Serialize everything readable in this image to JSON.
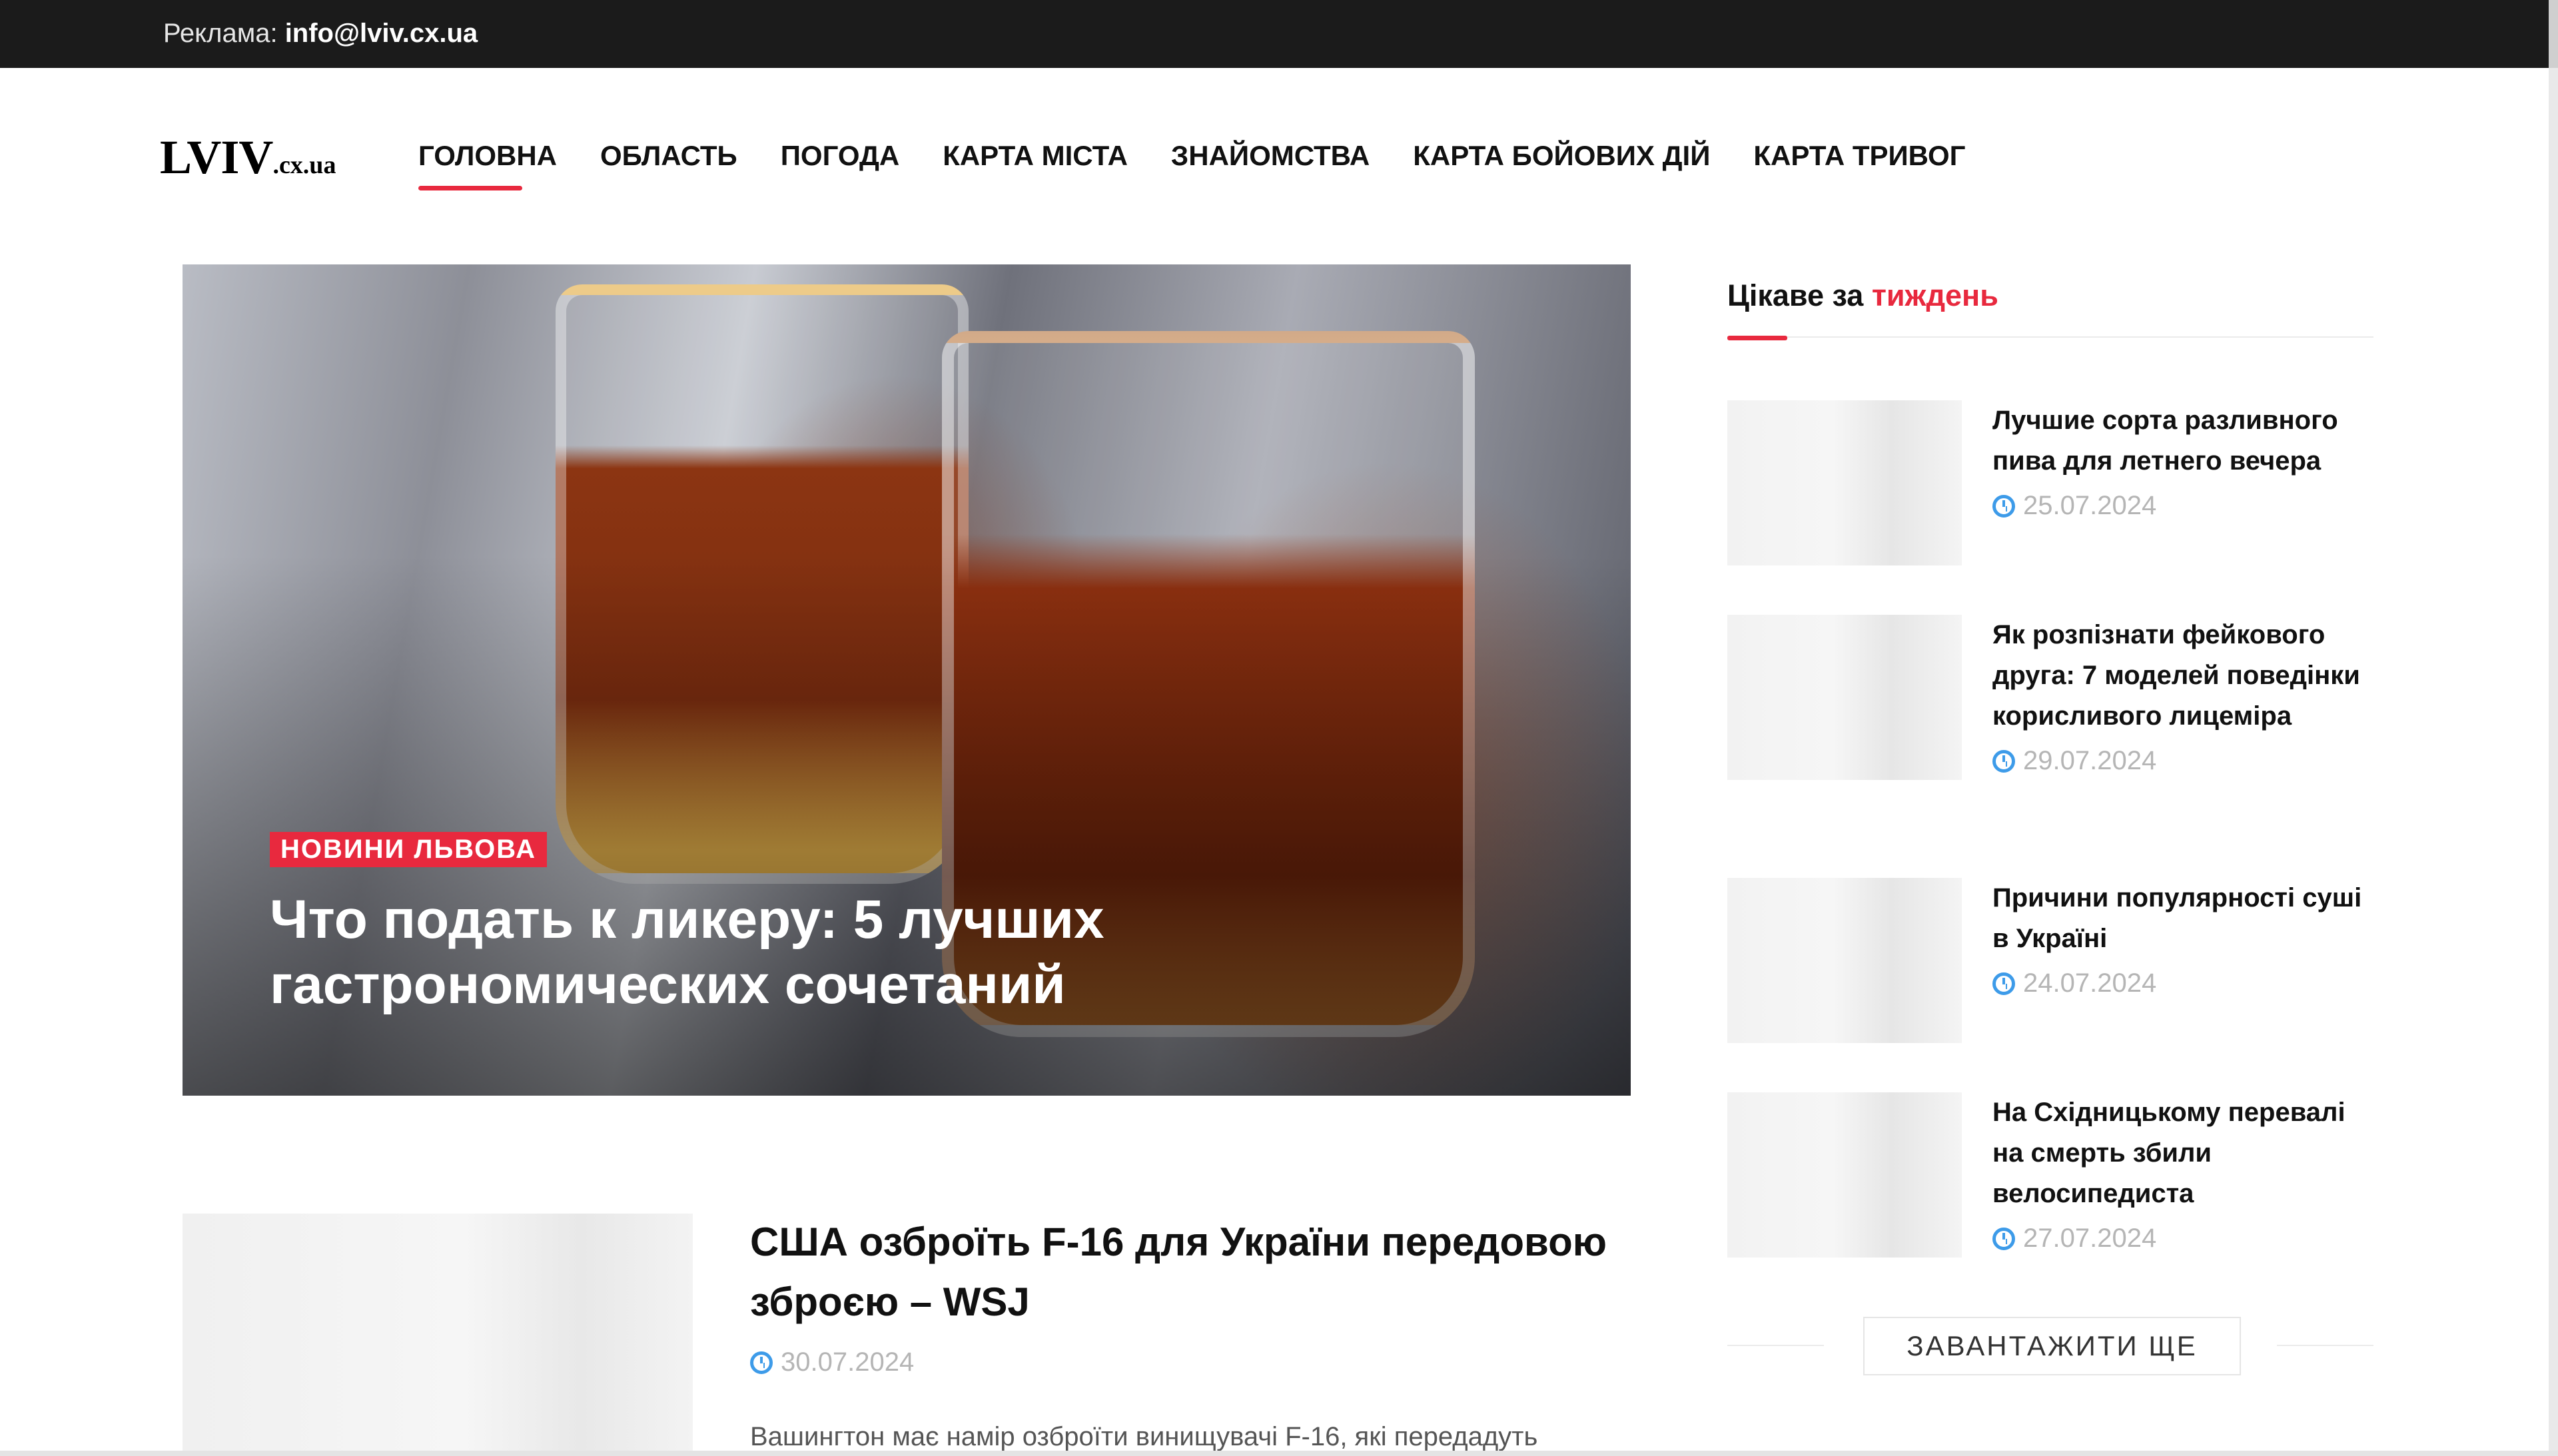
{
  "topbar": {
    "ad_label": "Реклама:",
    "ad_email": "info@lviv.cx.ua"
  },
  "header": {
    "logo_main": "LVIV",
    "logo_suffix": ".cx.ua",
    "nav": [
      {
        "label": "ГОЛОВНА",
        "active": true
      },
      {
        "label": "ОБЛАСТЬ"
      },
      {
        "label": "ПОГОДА"
      },
      {
        "label": "КАРТА МІСТА"
      },
      {
        "label": "ЗНАЙОМСТВА"
      },
      {
        "label": "КАРТА БОЙОВИХ ДІЙ"
      },
      {
        "label": "КАРТА ТРИВОГ"
      }
    ]
  },
  "hero": {
    "category": "НОВИНИ ЛЬВОВА",
    "title": "Что подать к ликеру: 5 лучших гастрономических сочетаний"
  },
  "sidebar": {
    "title_prefix": "Цікаве за",
    "title_accent": "тиждень",
    "items": [
      {
        "title": "Лучшие сорта разливного пива для летнего вечера",
        "date": "25.07.2024"
      },
      {
        "title": "Як розпізнати фейкового друга: 7 моделей поведінки корисливого лицеміра",
        "date": "29.07.2024"
      },
      {
        "title": "Причини популярності суші в Україні",
        "date": "24.07.2024"
      },
      {
        "title": "На Східницькому перевалі на смерть збили велосипедиста",
        "date": "27.07.2024"
      }
    ],
    "load_more": "ЗАВАНТАЖИТИ ЩЕ"
  },
  "article": {
    "title": "США озброїть F-16 для України передовою зброєю – WSJ",
    "date": "30.07.2024",
    "excerpt": "Вашингтон має намір озброїти винищувачі F-16, які передадуть"
  },
  "colors": {
    "accent": "#e8293e",
    "topbar": "#1b1b1b",
    "date_icon": "#3d9be9"
  }
}
